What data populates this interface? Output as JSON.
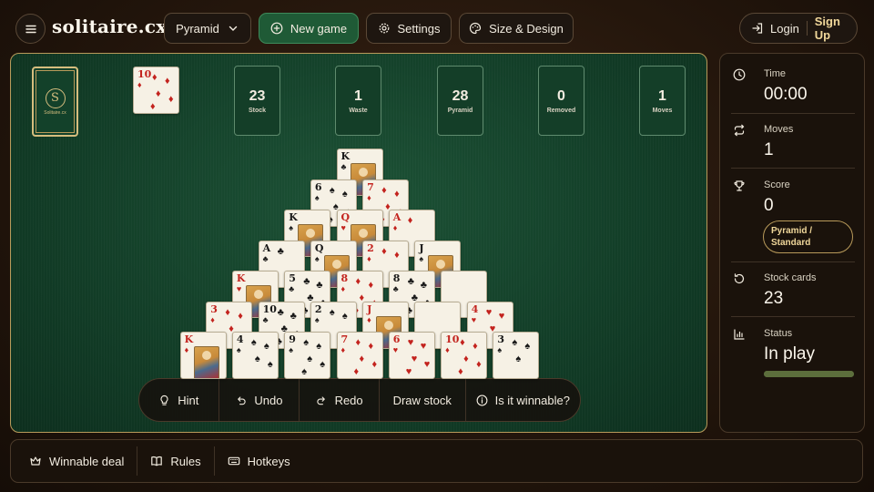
{
  "header": {
    "logo": "solitaire.cx",
    "variant_label": "Pyramid",
    "new_game_label": "New game",
    "settings_label": "Settings",
    "design_label": "Size & Design",
    "login_label": "Login",
    "signup_label": "Sign Up"
  },
  "board": {
    "stock_seal": "S",
    "stock_brand": "Solitaire.cx",
    "waste": {
      "rank": "10",
      "suit": "♦",
      "color": "red"
    },
    "counters": [
      {
        "value": "23",
        "label": "Stock"
      },
      {
        "value": "1",
        "label": "Waste"
      },
      {
        "value": "28",
        "label": "Pyramid"
      },
      {
        "value": "0",
        "label": "Removed"
      },
      {
        "value": "1",
        "label": "Moves"
      }
    ],
    "pyramid": [
      [
        {
          "rank": "K",
          "suit": "♣",
          "color": "black"
        }
      ],
      [
        {
          "rank": "6",
          "suit": "♠",
          "color": "black"
        },
        {
          "rank": "7",
          "suit": "♦",
          "color": "red"
        }
      ],
      [
        {
          "rank": "K",
          "suit": "♠",
          "color": "black"
        },
        {
          "rank": "Q",
          "suit": "♥",
          "color": "red"
        },
        {
          "rank": "A",
          "suit": "♦",
          "color": "red"
        }
      ],
      [
        {
          "rank": "A",
          "suit": "♣",
          "color": "black"
        },
        {
          "rank": "Q",
          "suit": "♠",
          "color": "black"
        },
        {
          "rank": "2",
          "suit": "♦",
          "color": "red"
        },
        {
          "rank": "J",
          "suit": "♠",
          "color": "black"
        }
      ],
      [
        {
          "rank": "K",
          "suit": "♥",
          "color": "red"
        },
        {
          "rank": "5",
          "suit": "♣",
          "color": "black"
        },
        {
          "rank": "8",
          "suit": "♦",
          "color": "red"
        },
        {
          "rank": "8",
          "suit": "♣",
          "color": "black"
        },
        {
          "rank": "",
          "suit": "",
          "color": "red"
        }
      ],
      [
        {
          "rank": "3",
          "suit": "♦",
          "color": "red"
        },
        {
          "rank": "10",
          "suit": "♣",
          "color": "black"
        },
        {
          "rank": "2",
          "suit": "♠",
          "color": "black"
        },
        {
          "rank": "J",
          "suit": "♦",
          "color": "red"
        },
        {
          "rank": "",
          "suit": "",
          "color": "red"
        },
        {
          "rank": "4",
          "suit": "♥",
          "color": "red"
        }
      ],
      [
        {
          "rank": "K",
          "suit": "♦",
          "color": "red"
        },
        {
          "rank": "4",
          "suit": "♠",
          "color": "black"
        },
        {
          "rank": "9",
          "suit": "♠",
          "color": "black"
        },
        {
          "rank": "7",
          "suit": "♦",
          "color": "red"
        },
        {
          "rank": "6",
          "suit": "♥",
          "color": "red"
        },
        {
          "rank": "10",
          "suit": "♦",
          "color": "red"
        },
        {
          "rank": "3",
          "suit": "♠",
          "color": "black"
        }
      ]
    ],
    "actions": {
      "hint": "Hint",
      "undo": "Undo",
      "redo": "Redo",
      "draw": "Draw stock",
      "winnable": "Is it winnable?"
    }
  },
  "panel": {
    "time_label": "Time",
    "time_value": "00:00",
    "moves_label": "Moves",
    "moves_value": "1",
    "score_label": "Score",
    "score_value": "0",
    "mode_badge": "Pyramid / Standard",
    "stock_label": "Stock cards",
    "stock_value": "23",
    "status_label": "Status",
    "status_value": "In play",
    "status_progress": 1.0
  },
  "footer": {
    "winnable": "Winnable deal",
    "rules": "Rules",
    "hotkeys": "Hotkeys"
  },
  "colors": {
    "felt": "#123d27",
    "accent_gold": "#b89a5a",
    "new_game_green": "#1f5a36",
    "red_suit": "#c3231e"
  }
}
